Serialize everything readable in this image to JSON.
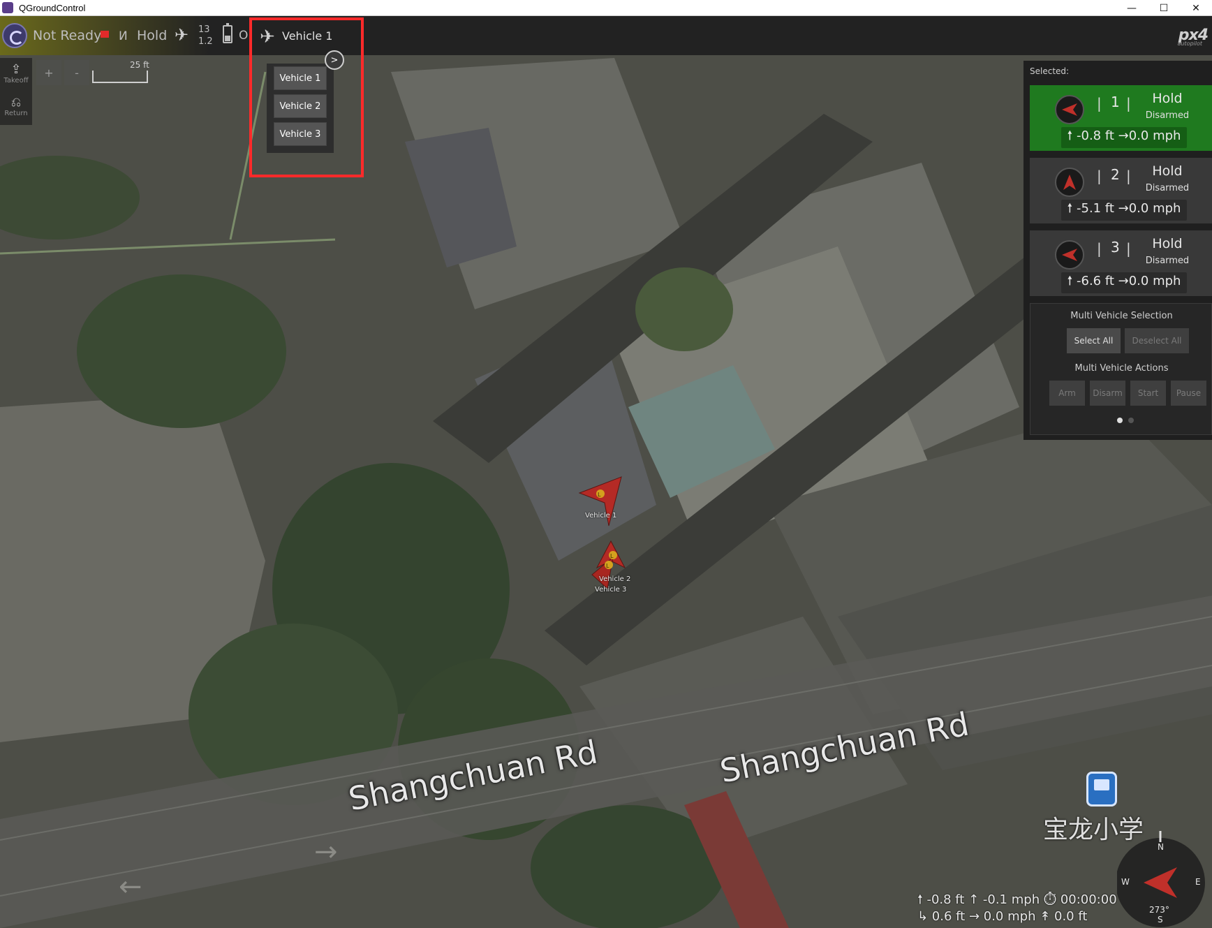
{
  "window": {
    "title": "QGroundControl",
    "minimize": "—",
    "maximize": "☐",
    "close": "✕"
  },
  "toolbar": {
    "status": "Not Ready",
    "flight_mode": "Hold",
    "gps_count": "13",
    "gps_hdop": "1.2",
    "battery_text": "O",
    "active_vehicle": "Vehicle 1",
    "brand": "px4",
    "brand_sub": "autopilot"
  },
  "vehicle_menu": {
    "toggle": ">",
    "items": [
      "Vehicle 1",
      "Vehicle 2",
      "Vehicle 3"
    ]
  },
  "left_tools": {
    "takeoff": "Takeoff",
    "return": "Return",
    "zoom_in": "+",
    "zoom_out": "-",
    "scale": "25 ft"
  },
  "right_panel": {
    "selected_label": "Selected:",
    "vehicles": [
      {
        "id": "1",
        "mode": "Hold",
        "arm": "Disarmed",
        "telemetry": "🠕 -0.8 ft →0.0 mph"
      },
      {
        "id": "2",
        "mode": "Hold",
        "arm": "Disarmed",
        "telemetry": "🠕 -5.1 ft →0.0 mph"
      },
      {
        "id": "3",
        "mode": "Hold",
        "arm": "Disarmed",
        "telemetry": "🠕 -6.6 ft →0.0 mph"
      }
    ],
    "multi_selection_title": "Multi Vehicle Selection",
    "select_all": "Select All",
    "deselect_all": "Deselect All",
    "multi_actions_title": "Multi Vehicle Actions",
    "arm": "Arm",
    "disarm": "Disarm",
    "start": "Start",
    "pause": "Pause"
  },
  "map": {
    "road_label_1": "Shangchuan Rd",
    "road_label_2": "Shangchuan Rd",
    "school_label": "宝龙小学",
    "vehicle_labels": [
      "Vehicle 1",
      "Vehicle 2",
      "Vehicle 3"
    ],
    "marker_letter": "L"
  },
  "bottom_telemetry": {
    "line1": "🠕 -0.8 ft  ↑ -0.1 mph  ⏱ 00:00:00",
    "line2": "↳ 0.6 ft  → 0.0 mph  ↟ 0.0 ft"
  },
  "compass": {
    "n": "N",
    "e": "E",
    "s": "S",
    "w": "W",
    "heading": "273°"
  },
  "colors": {
    "accent_green": "#1f7a1f",
    "highlight_red": "#ff2a2a",
    "vehicle_red": "#c0302a"
  }
}
